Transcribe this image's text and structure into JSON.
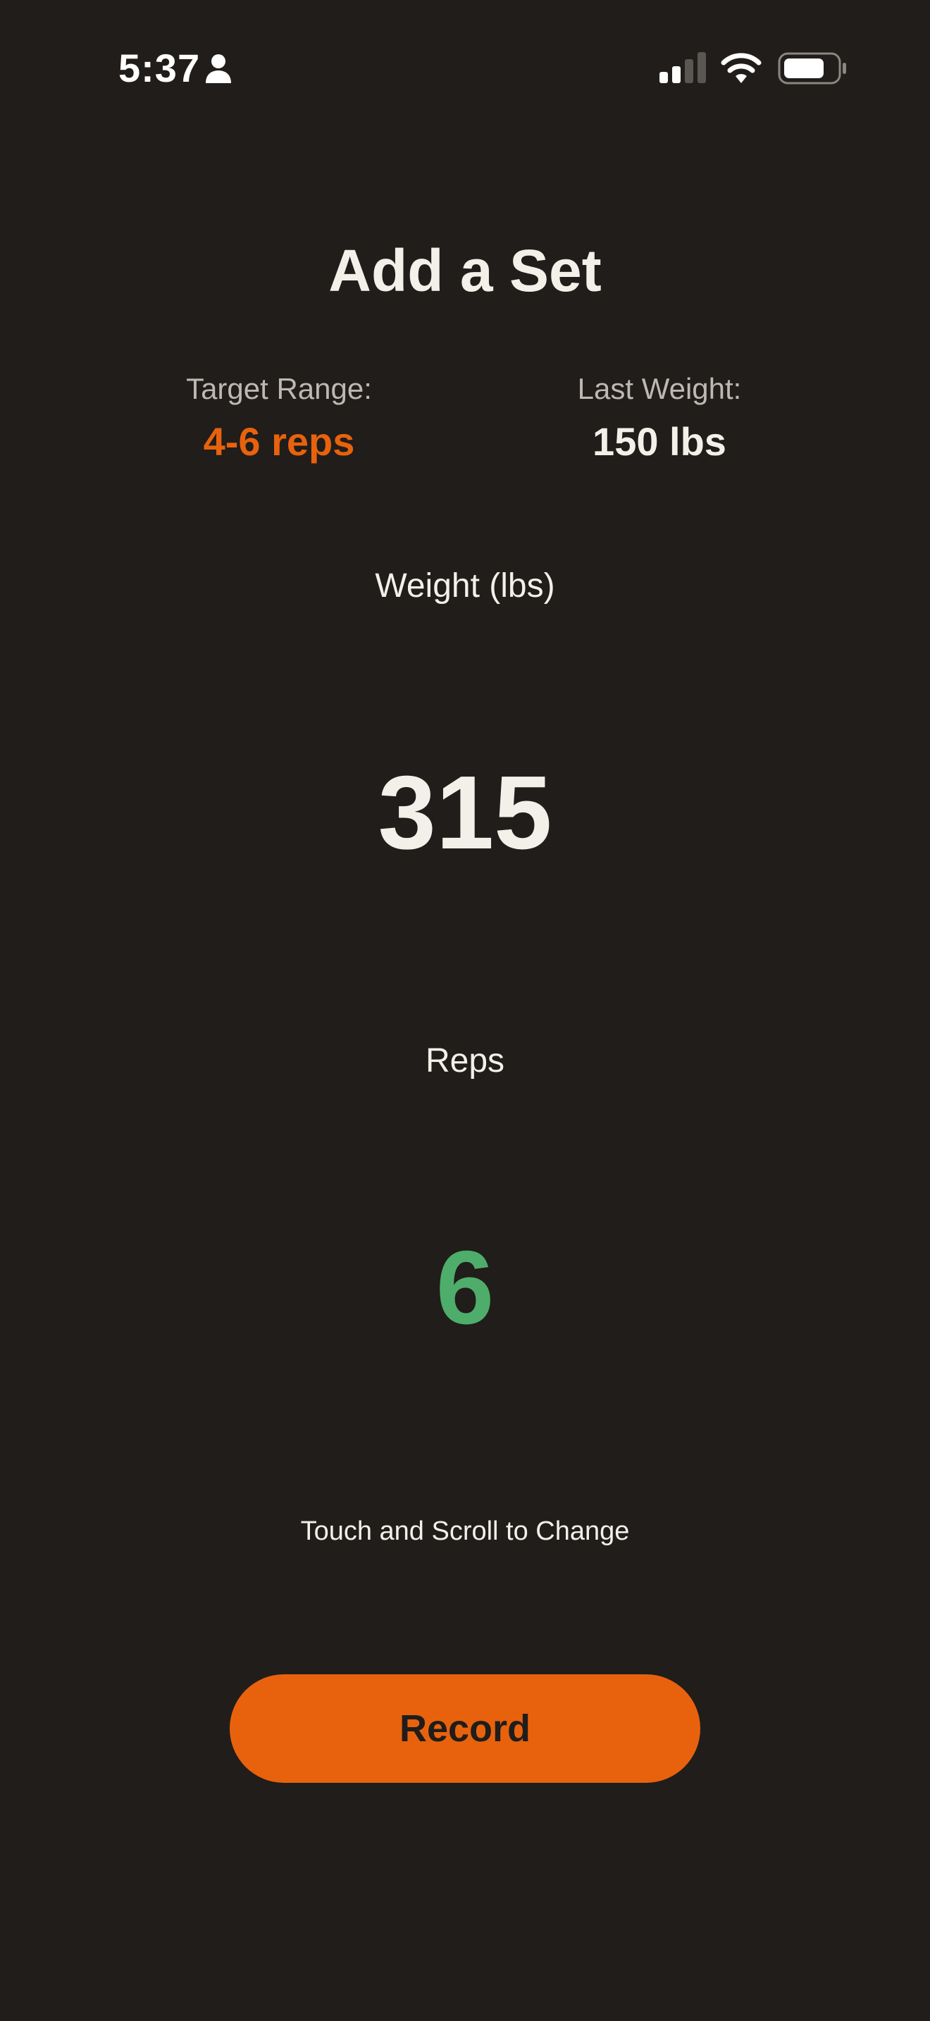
{
  "status_bar": {
    "time": "5:37",
    "icons": [
      "person-icon",
      "cellular-signal-icon",
      "wifi-icon",
      "battery-icon"
    ]
  },
  "header": {
    "title": "Add a Set"
  },
  "target": {
    "label": "Target Range:",
    "value": "4-6 reps"
  },
  "last_weight": {
    "label": "Last Weight:",
    "value": "150 lbs"
  },
  "weight": {
    "label": "Weight (lbs)",
    "value": "315"
  },
  "reps": {
    "label": "Reps",
    "value": "6"
  },
  "hint": "Touch and Scroll to Change",
  "actions": {
    "record_label": "Record"
  },
  "colors": {
    "background": "#201d1a",
    "accent_orange": "#e8620e",
    "reps_green": "#4fad6b",
    "text": "#f3efe9"
  }
}
